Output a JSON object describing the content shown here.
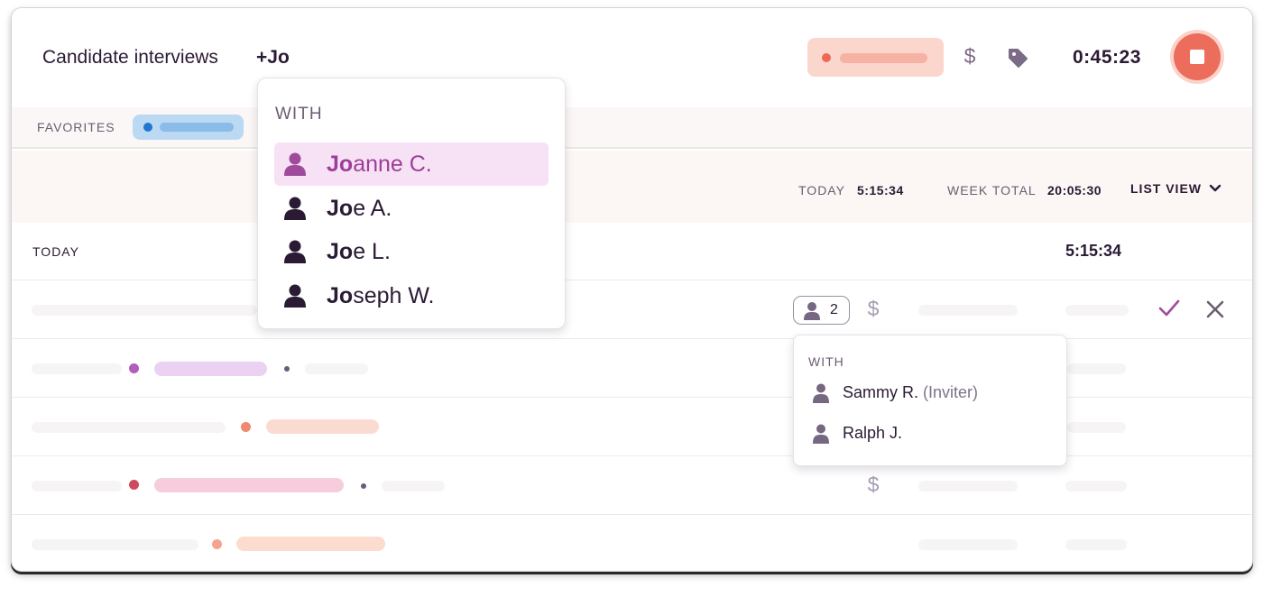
{
  "header": {
    "task_title": "Candidate interviews",
    "mention_text": "+Jo",
    "timer": "0:45:23",
    "icons": {
      "billable": "dollar-icon",
      "tag": "tag-icon",
      "stop": "stop-icon"
    }
  },
  "favorites": {
    "label": "FAVORITES"
  },
  "totals": {
    "today_label": "TODAY",
    "today_value": "5:15:34",
    "week_label": "WEEK TOTAL",
    "week_value": "20:05:30",
    "view_label": "LIST VIEW"
  },
  "day": {
    "label": "TODAY",
    "total": "5:15:34"
  },
  "rows": {
    "people_count": "2",
    "dollar_glyph": "$"
  },
  "dropdown": {
    "header": "WITH",
    "items": [
      {
        "match": "Jo",
        "rest": "anne C.",
        "selected": true
      },
      {
        "match": "Jo",
        "rest": "e A.",
        "selected": false
      },
      {
        "match": "Jo",
        "rest": "e L.",
        "selected": false
      },
      {
        "match": "Jo",
        "rest": "seph W.",
        "selected": false
      }
    ]
  },
  "popover": {
    "header": "WITH",
    "people": [
      {
        "name": "Sammy R.",
        "role": "(Inviter)"
      },
      {
        "name": "Ralph J.",
        "role": ""
      }
    ]
  },
  "colors": {
    "accent_purple": "#9d3f98",
    "stop_red": "#ec6d5c",
    "project_pill": "#fbd6cc",
    "favorite_pill": "#bcd9f3",
    "text_dark": "#2a1a33"
  }
}
